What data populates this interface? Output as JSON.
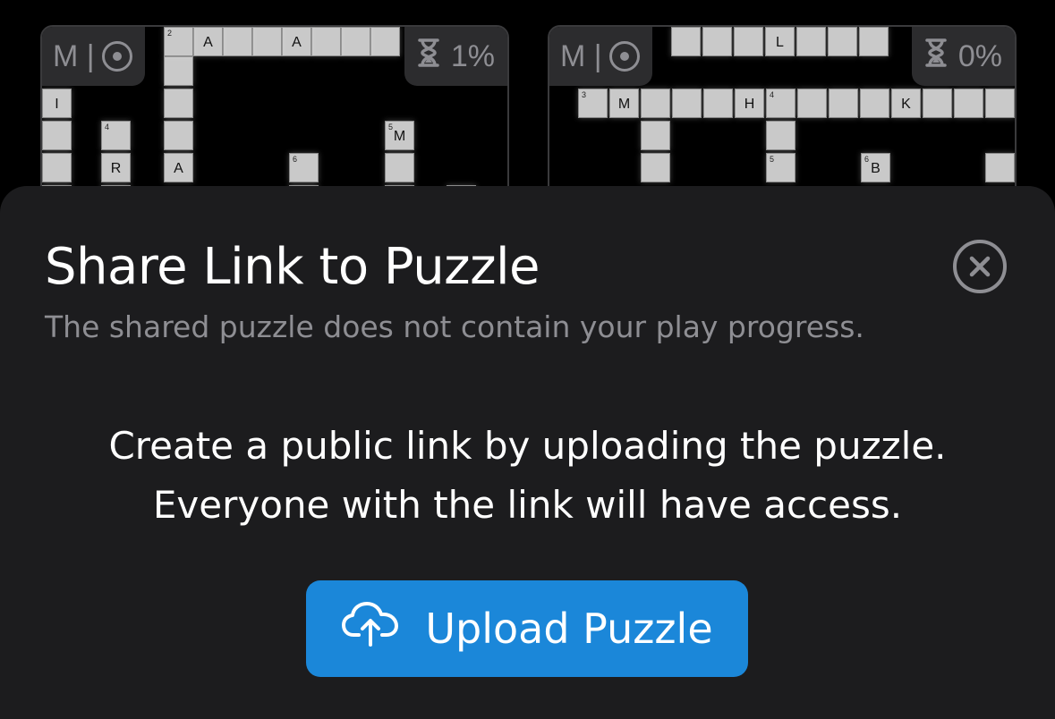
{
  "puzzles": [
    {
      "mode_label": "M |",
      "progress": "1%",
      "cells": [
        {
          "num": "2",
          "letter": ""
        },
        {
          "num": "",
          "letter": "A"
        },
        {
          "num": "",
          "letter": ""
        },
        {
          "num": "",
          "letter": ""
        },
        {
          "num": "",
          "letter": "A"
        },
        {
          "num": "",
          "letter": ""
        },
        {
          "num": "",
          "letter": ""
        },
        {
          "num": "",
          "letter": ""
        },
        {
          "num": "",
          "letter": ""
        },
        {
          "num": "",
          "letter": "I"
        },
        {
          "num": "",
          "letter": ""
        },
        {
          "num": "4",
          "letter": ""
        },
        {
          "num": "",
          "letter": ""
        },
        {
          "num": "5",
          "letter": "M"
        },
        {
          "num": "",
          "letter": ""
        },
        {
          "num": "",
          "letter": "R"
        },
        {
          "num": "",
          "letter": "A"
        },
        {
          "num": "6",
          "letter": ""
        },
        {
          "num": "",
          "letter": ""
        },
        {
          "num": "",
          "letter": ""
        },
        {
          "num": "",
          "letter": ""
        },
        {
          "num": "",
          "letter": ""
        },
        {
          "num": "",
          "letter": ""
        },
        {
          "num": "",
          "letter": ""
        },
        {
          "num": "",
          "letter": ""
        }
      ]
    },
    {
      "mode_label": "M |",
      "progress": "0%",
      "cells": [
        {
          "num": "",
          "letter": ""
        },
        {
          "num": "",
          "letter": ""
        },
        {
          "num": "",
          "letter": ""
        },
        {
          "num": "",
          "letter": "L"
        },
        {
          "num": "",
          "letter": ""
        },
        {
          "num": "",
          "letter": ""
        },
        {
          "num": "",
          "letter": ""
        },
        {
          "num": "3",
          "letter": ""
        },
        {
          "num": "",
          "letter": "M"
        },
        {
          "num": "",
          "letter": ""
        },
        {
          "num": "",
          "letter": ""
        },
        {
          "num": "",
          "letter": ""
        },
        {
          "num": "",
          "letter": "H"
        },
        {
          "num": "4",
          "letter": ""
        },
        {
          "num": "",
          "letter": ""
        },
        {
          "num": "",
          "letter": ""
        },
        {
          "num": "",
          "letter": ""
        },
        {
          "num": "",
          "letter": "K"
        },
        {
          "num": "",
          "letter": ""
        },
        {
          "num": "",
          "letter": ""
        },
        {
          "num": "",
          "letter": ""
        },
        {
          "num": "",
          "letter": ""
        },
        {
          "num": "",
          "letter": ""
        },
        {
          "num": "",
          "letter": ""
        },
        {
          "num": "5",
          "letter": ""
        },
        {
          "num": "6",
          "letter": "B"
        },
        {
          "num": "",
          "letter": ""
        }
      ]
    }
  ],
  "sheet": {
    "title": "Share Link to Puzzle",
    "subtitle": "The shared puzzle does not contain your play progress.",
    "body_line1": "Create a public link by uploading the puzzle.",
    "body_line2": "Everyone with the link will have access.",
    "upload_label": "Upload Puzzle"
  },
  "colors": {
    "background": "#000000",
    "sheet": "#1c1c1e",
    "accent": "#1b87d9",
    "secondary_text": "#8e8e93",
    "cell": "#c9c9c9"
  },
  "icons": {
    "close": "xmark-circle-icon",
    "upload": "cloud-upload-icon",
    "target": "target-icon",
    "timer": "hourglass-icon"
  }
}
